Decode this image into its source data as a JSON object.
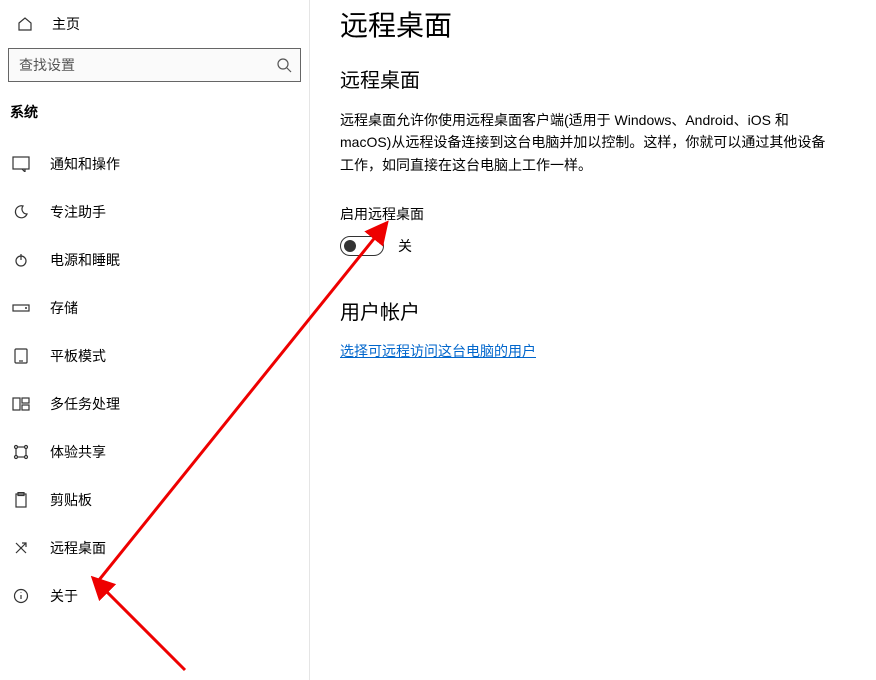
{
  "header": {
    "home_label": "主页"
  },
  "search": {
    "placeholder": "查找设置"
  },
  "section": {
    "label": "系统"
  },
  "sidebar": {
    "items": [
      {
        "label": "通知和操作"
      },
      {
        "label": "专注助手"
      },
      {
        "label": "电源和睡眠"
      },
      {
        "label": "存储"
      },
      {
        "label": "平板模式"
      },
      {
        "label": "多任务处理"
      },
      {
        "label": "体验共享"
      },
      {
        "label": "剪贴板"
      },
      {
        "label": "远程桌面"
      },
      {
        "label": "关于"
      }
    ]
  },
  "main": {
    "page_title": "远程桌面",
    "section1_heading": "远程桌面",
    "description": "远程桌面允许你使用远程桌面客户端(适用于 Windows、Android、iOS 和 macOS)从远程设备连接到这台电脑并加以控制。这样，你就可以通过其他设备工作，如同直接在这台电脑上工作一样。",
    "toggle_label": "启用远程桌面",
    "toggle_state": "关",
    "section2_heading": "用户帐户",
    "link_text": "选择可远程访问这台电脑的用户"
  }
}
